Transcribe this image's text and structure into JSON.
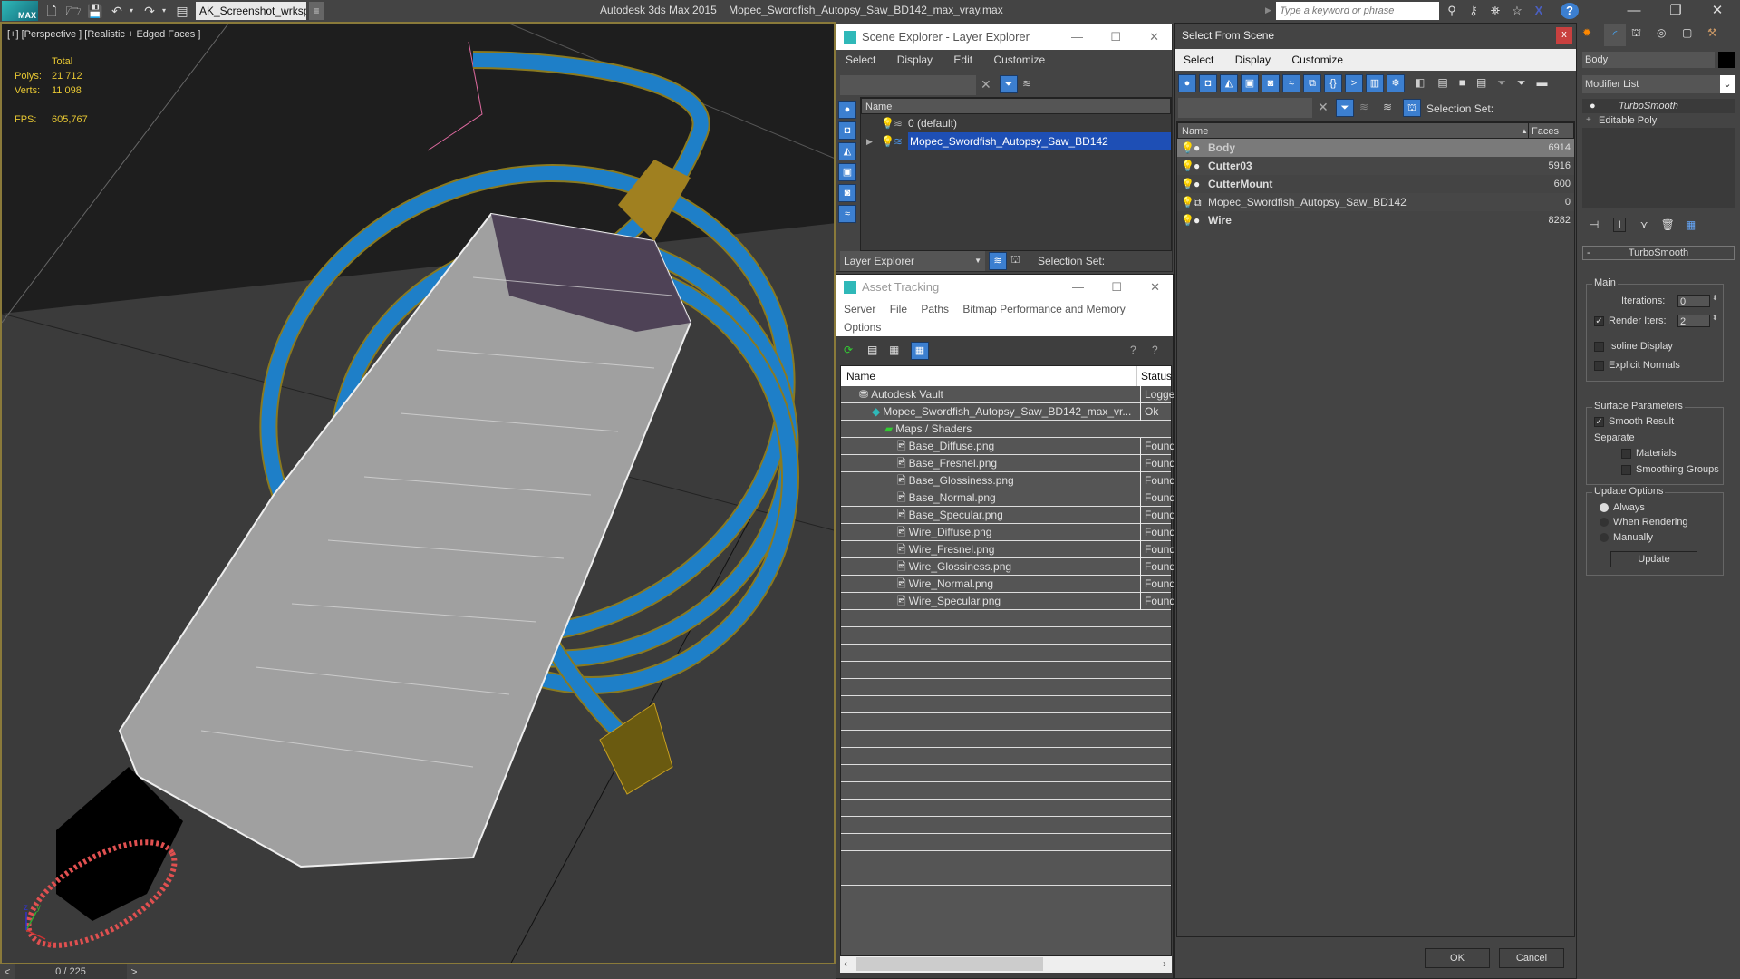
{
  "app": {
    "title": "Autodesk 3ds Max  2015",
    "file": "Mopec_Swordfish_Autopsy_Saw_BD142_max_vray.max",
    "logo": "MAX",
    "workspace": "AK_Screenshot_wrksp",
    "search_placeholder": "Type a keyword or phrase"
  },
  "viewport": {
    "label": "[+] [Perspective ] [Realistic + Edged Faces ]",
    "stats": {
      "total_label": "Total",
      "polys_label": "Polys:",
      "polys": "21 712",
      "verts_label": "Verts:",
      "verts": "11 098",
      "fps_label": "FPS:",
      "fps": "605,767"
    },
    "axis": {
      "x": "x",
      "y": "y",
      "z": "z"
    }
  },
  "timeline": {
    "frame": "0 / 225",
    "prev": "<",
    "next": ">"
  },
  "scene_explorer": {
    "title": "Scene Explorer - Layer Explorer",
    "menu": [
      "Select",
      "Display",
      "Edit",
      "Customize"
    ],
    "column": "Name",
    "layers": [
      {
        "name": "0 (default)",
        "selected": false
      },
      {
        "name": "Mopec_Swordfish_Autopsy_Saw_BD142",
        "selected": true
      }
    ],
    "explorer_dropdown": "Layer Explorer",
    "selection_set_label": "Selection Set:"
  },
  "asset_tracking": {
    "title": "Asset Tracking",
    "menu": [
      "Server",
      "File",
      "Paths",
      "Bitmap Performance and Memory",
      "Options"
    ],
    "columns": [
      "Name",
      "Status"
    ],
    "rows": [
      {
        "name": "Autodesk Vault",
        "status": "Logged",
        "indent": 0,
        "icon": "vault-icon"
      },
      {
        "name": "Mopec_Swordfish_Autopsy_Saw_BD142_max_vr...",
        "status": "Ok",
        "indent": 1,
        "icon": "max-file-icon"
      },
      {
        "name": "Maps / Shaders",
        "status": "",
        "indent": 2,
        "icon": "maps-icon"
      },
      {
        "name": "Base_Diffuse.png",
        "status": "Found",
        "indent": 3,
        "icon": "bitmap-icon"
      },
      {
        "name": "Base_Fresnel.png",
        "status": "Found",
        "indent": 3,
        "icon": "bitmap-icon"
      },
      {
        "name": "Base_Glossiness.png",
        "status": "Found",
        "indent": 3,
        "icon": "bitmap-icon"
      },
      {
        "name": "Base_Normal.png",
        "status": "Found",
        "indent": 3,
        "icon": "bitmap-icon"
      },
      {
        "name": "Base_Specular.png",
        "status": "Found",
        "indent": 3,
        "icon": "bitmap-icon"
      },
      {
        "name": "Wire_Diffuse.png",
        "status": "Found",
        "indent": 3,
        "icon": "bitmap-icon"
      },
      {
        "name": "Wire_Fresnel.png",
        "status": "Found",
        "indent": 3,
        "icon": "bitmap-icon"
      },
      {
        "name": "Wire_Glossiness.png",
        "status": "Found",
        "indent": 3,
        "icon": "bitmap-icon"
      },
      {
        "name": "Wire_Normal.png",
        "status": "Found",
        "indent": 3,
        "icon": "bitmap-icon"
      },
      {
        "name": "Wire_Specular.png",
        "status": "Found",
        "indent": 3,
        "icon": "bitmap-icon"
      }
    ]
  },
  "select_from_scene": {
    "title": "Select From Scene",
    "close": "x",
    "menu": [
      "Select",
      "Display",
      "Customize"
    ],
    "selection_set_label": "Selection Set:",
    "columns": [
      "Name",
      "Faces"
    ],
    "objects": [
      {
        "name": "Body",
        "faces": "6914",
        "selected": true,
        "bold": true
      },
      {
        "name": "Cutter03",
        "faces": "5916",
        "selected": false,
        "bold": true
      },
      {
        "name": "CutterMount",
        "faces": "600",
        "selected": false,
        "bold": true
      },
      {
        "name": "Mopec_Swordfish_Autopsy_Saw_BD142",
        "faces": "0",
        "selected": false,
        "bold": false
      },
      {
        "name": "Wire",
        "faces": "8282",
        "selected": false,
        "bold": true
      }
    ],
    "ok": "OK",
    "cancel": "Cancel"
  },
  "command_panel": {
    "object_name": "Body",
    "modifier_list": "Modifier List",
    "stack": [
      "TurboSmooth",
      "Editable Poly"
    ],
    "rollout": {
      "title": "TurboSmooth",
      "collapse": "-",
      "main_label": "Main",
      "iterations_label": "Iterations:",
      "iterations": "0",
      "render_iters_label": "Render Iters:",
      "render_iters": "2",
      "render_iters_checked": true,
      "isoline_label": "Isoline Display",
      "explicit_label": "Explicit Normals",
      "surface_label": "Surface Parameters",
      "smooth_result_label": "Smooth Result",
      "separate_label": "Separate",
      "materials_label": "Materials",
      "smoothing_groups_label": "Smoothing Groups",
      "update_options_label": "Update Options",
      "always_label": "Always",
      "when_rendering_label": "When Rendering",
      "manually_label": "Manually",
      "update_button": "Update"
    }
  },
  "colors": {
    "accent_blue": "#3c7fd0",
    "selection_blue": "#1e4fb5",
    "stat_yellow": "#e8c833",
    "wire_blue": "#1e7fc8",
    "close_red": "#c9403f"
  }
}
